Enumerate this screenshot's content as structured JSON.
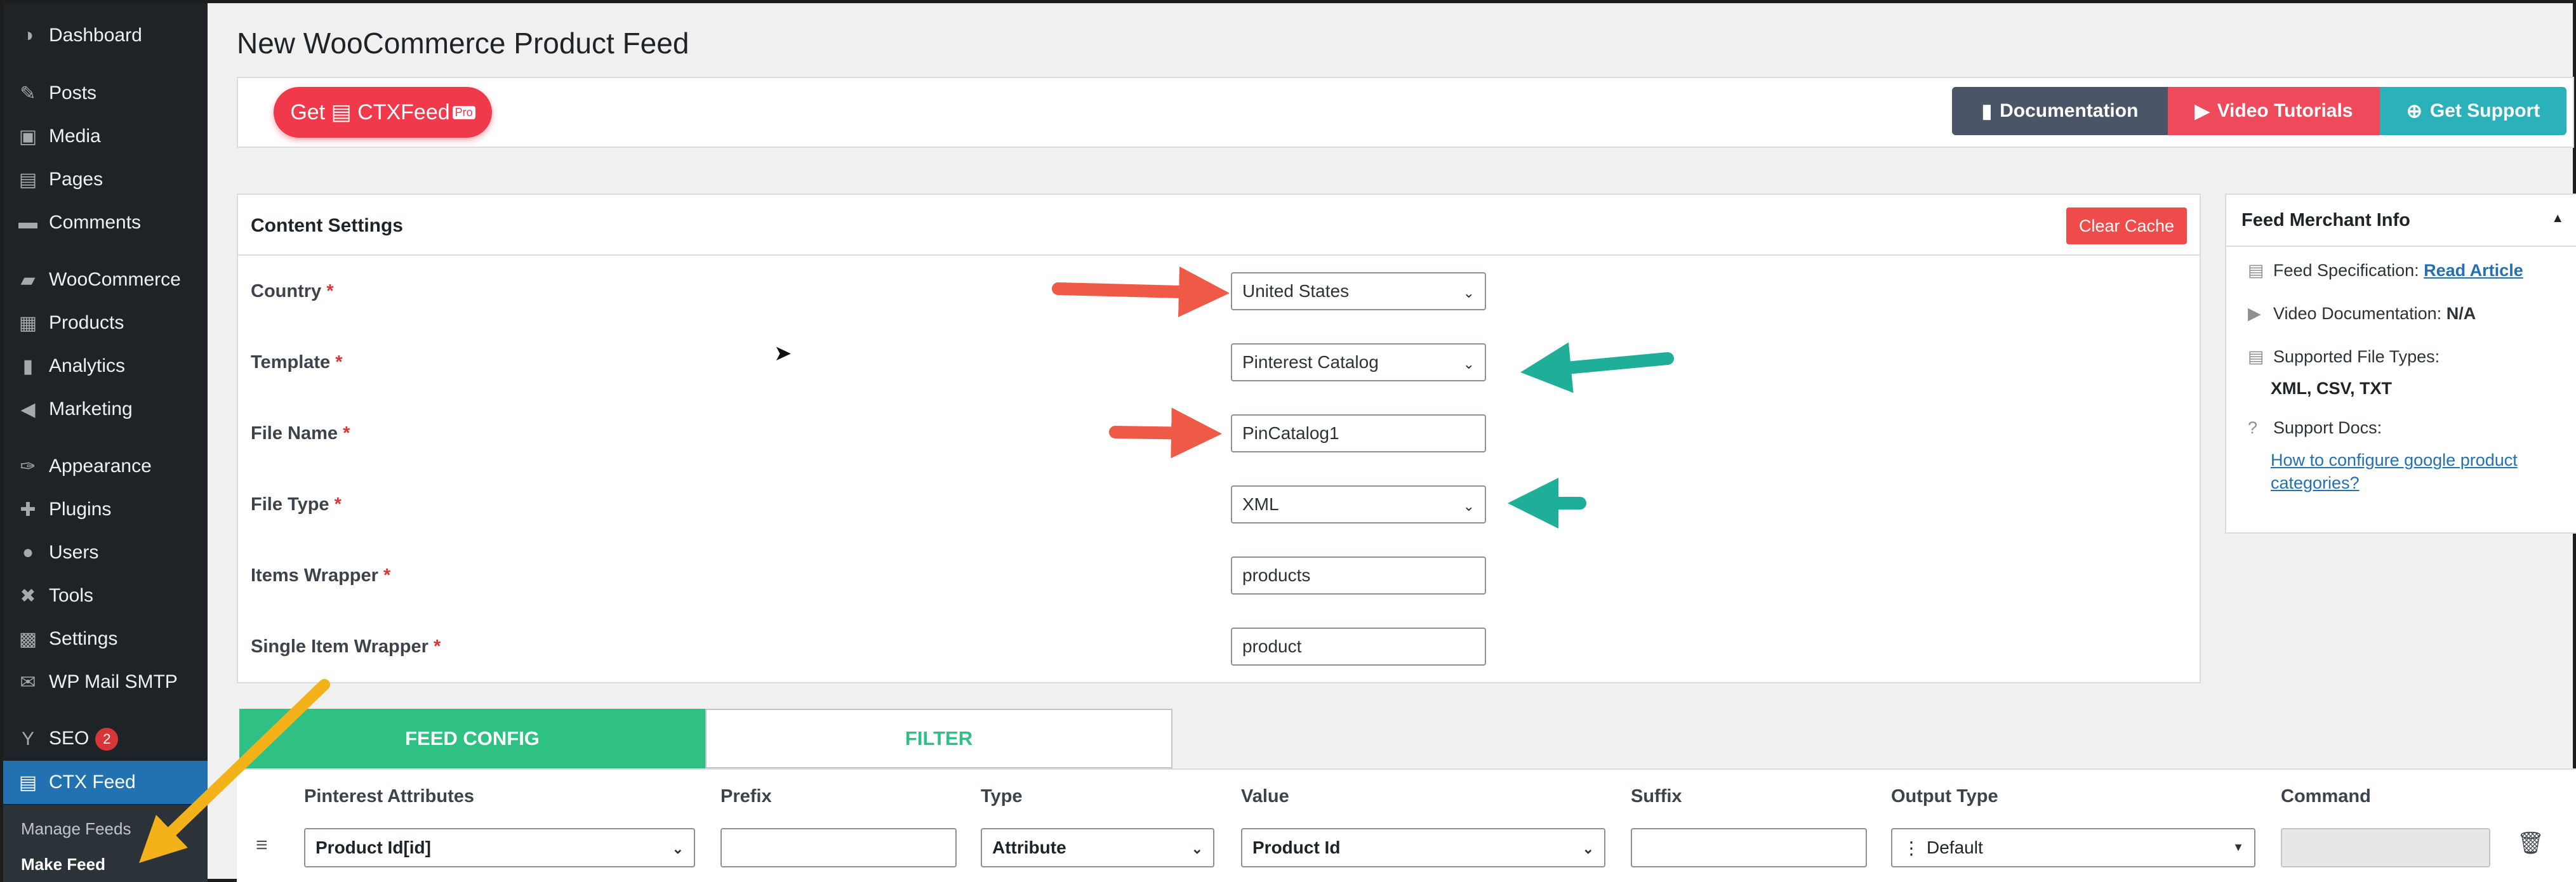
{
  "sidebar": {
    "items": [
      {
        "label": "Dashboard",
        "icon": "dashboard-icon",
        "glyph": "◑"
      },
      {
        "label": "Posts",
        "icon": "pushpin-icon",
        "glyph": "✎"
      },
      {
        "label": "Media",
        "icon": "media-icon",
        "glyph": "▣"
      },
      {
        "label": "Pages",
        "icon": "pages-icon",
        "glyph": "▤"
      },
      {
        "label": "Comments",
        "icon": "comments-icon",
        "glyph": "▬"
      },
      {
        "label": "WooCommerce",
        "icon": "woocommerce-icon",
        "glyph": "▰"
      },
      {
        "label": "Products",
        "icon": "products-icon",
        "glyph": "▦"
      },
      {
        "label": "Analytics",
        "icon": "analytics-icon",
        "glyph": "▮"
      },
      {
        "label": "Marketing",
        "icon": "megaphone-icon",
        "glyph": "◀"
      },
      {
        "label": "Appearance",
        "icon": "paintbrush-icon",
        "glyph": "✑"
      },
      {
        "label": "Plugins",
        "icon": "plugins-icon",
        "glyph": "✚"
      },
      {
        "label": "Users",
        "icon": "users-icon",
        "glyph": "●"
      },
      {
        "label": "Tools",
        "icon": "wrench-icon",
        "glyph": "✖"
      },
      {
        "label": "Settings",
        "icon": "settings-icon",
        "glyph": "▩"
      },
      {
        "label": "WP Mail SMTP",
        "icon": "mail-icon",
        "glyph": "✉"
      },
      {
        "label": "SEO",
        "icon": "yoast-icon",
        "glyph": "Y",
        "badge": "2"
      },
      {
        "label": "CTX Feed",
        "icon": "feed-icon",
        "glyph": "▤"
      }
    ],
    "submenu": [
      "Manage Feeds",
      "Make Feed"
    ]
  },
  "page": {
    "title": "New WooCommerce Product Feed"
  },
  "topbar": {
    "get_pro": "Get",
    "get_pro_brand": "CTXFeed",
    "get_pro_badge": "Pro",
    "doc": "Documentation",
    "video": "Video Tutorials",
    "support": "Get Support"
  },
  "content": {
    "title": "Content Settings",
    "clear_cache": "Clear Cache",
    "fields": [
      {
        "label": "Country",
        "value": "United States",
        "type": "select"
      },
      {
        "label": "Template",
        "value": "Pinterest Catalog",
        "type": "select"
      },
      {
        "label": "File Name",
        "value": "PinCatalog1",
        "type": "input"
      },
      {
        "label": "File Type",
        "value": "XML",
        "type": "select"
      },
      {
        "label": "Items Wrapper",
        "value": "products",
        "type": "input"
      },
      {
        "label": "Single Item Wrapper",
        "value": "product",
        "type": "input"
      }
    ]
  },
  "merchant": {
    "title": "Feed Merchant Info",
    "spec_label": "Feed Specification:",
    "spec_link": "Read Article",
    "video_label": "Video Documentation:",
    "video_value": "N/A",
    "types_label": "Supported File Types:",
    "types_value": "XML, CSV, TXT",
    "docs_label": "Support Docs:",
    "docs_link_1": "How to configure google product",
    "docs_link_2": "categories?"
  },
  "tabs": {
    "config": "FEED CONFIG",
    "filter": "FILTER"
  },
  "table": {
    "headers": [
      "Pinterest Attributes",
      "Prefix",
      "Type",
      "Value",
      "Suffix",
      "Output Type",
      "Command"
    ],
    "row": {
      "attribute": "Product Id[id]",
      "prefix": "",
      "type": "Attribute",
      "value": "Product Id",
      "suffix": "",
      "output": "Default",
      "command": ""
    }
  },
  "colors": {
    "red_arrow": "#ef5a48",
    "teal_arrow": "#1fae98",
    "yellow_arrow": "#f4b21a"
  }
}
